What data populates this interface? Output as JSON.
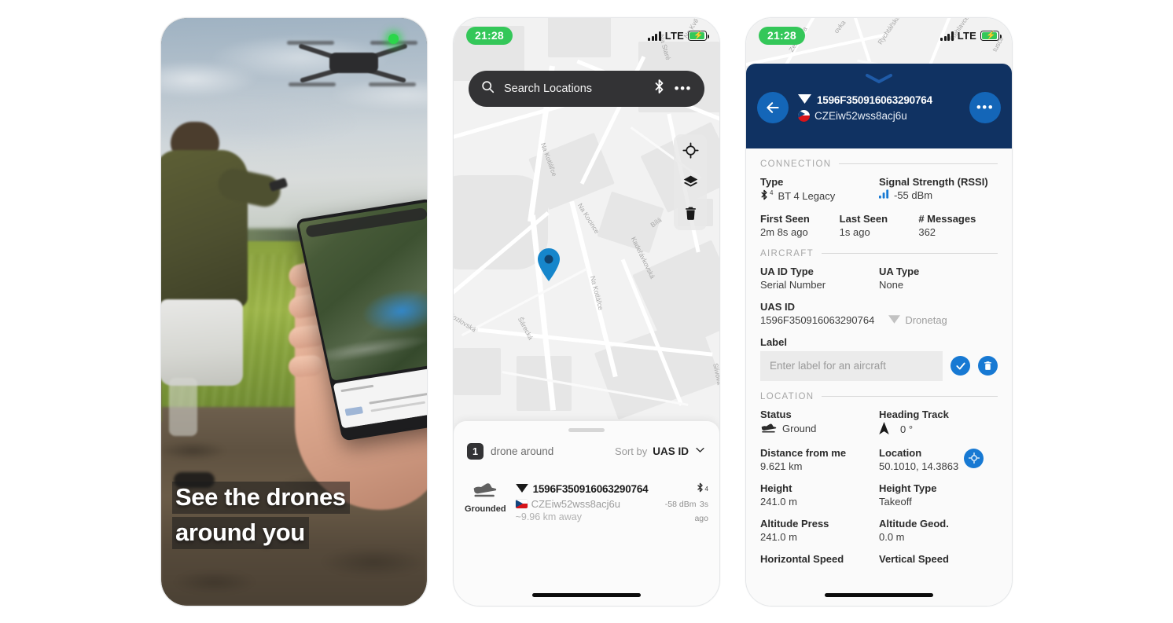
{
  "hero": {
    "caption_line1": "See the drones",
    "caption_line2": "around you"
  },
  "status_bar": {
    "time": "21:28",
    "network": "LTE",
    "battery_charging": true
  },
  "map_screen": {
    "search": {
      "placeholder": "Search Locations"
    },
    "tools": [
      {
        "name": "locate-icon"
      },
      {
        "name": "layers-icon"
      },
      {
        "name": "trash-icon"
      }
    ],
    "street_labels": [
      "Na Kocince",
      "Na Kotlářce",
      "Na Kotlářce",
      "Kadeřávkovská",
      "Šárecká",
      "Kozlovská",
      "Bílá",
      "Na Staré",
      "Na Kvě",
      "Slívova"
    ],
    "sheet": {
      "count": "1",
      "count_label": "drone around",
      "sort_label": "Sort by",
      "sort_value": "UAS ID",
      "rows": [
        {
          "status": "Grounded",
          "uas_id": "1596F350916063290764",
          "operator_id": "CZEiw52wss8acj6u",
          "distance": "~9.96 km away",
          "bt_version": "4",
          "rssi": "-58 dBm",
          "last_seen": "3s ago",
          "flag": "cz"
        }
      ]
    }
  },
  "detail_screen": {
    "header": {
      "uas_id": "1596F350916063290764",
      "operator_id": "CZEiw52wss8acj6u"
    },
    "sections": {
      "connection": {
        "title": "CONNECTION",
        "type_label": "Type",
        "type_value": "BT 4 Legacy",
        "rssi_label": "Signal Strength (RSSI)",
        "rssi_value": "-55 dBm",
        "first_seen_label": "First Seen",
        "first_seen_value": "2m 8s ago",
        "last_seen_label": "Last Seen",
        "last_seen_value": "1s ago",
        "messages_label": "# Messages",
        "messages_value": "362"
      },
      "aircraft": {
        "title": "AIRCRAFT",
        "ua_id_type_label": "UA ID Type",
        "ua_id_type_value": "Serial Number",
        "ua_type_label": "UA Type",
        "ua_type_value": "None",
        "uas_id_label": "UAS ID",
        "uas_id_value": "1596F350916063290764",
        "vendor": "Dronetag",
        "label_label": "Label",
        "label_placeholder": "Enter label for an aircraft"
      },
      "location": {
        "title": "LOCATION",
        "status_label": "Status",
        "status_value": "Ground",
        "heading_label": "Heading Track",
        "heading_value": "0 °",
        "distance_label": "Distance from me",
        "distance_value": "9.621 km",
        "location_label": "Location",
        "location_value": "50.1010, 14.3863",
        "height_label": "Height",
        "height_value": "241.0 m",
        "height_type_label": "Height Type",
        "height_type_value": "Takeoff",
        "alt_press_label": "Altitude Press",
        "alt_press_value": "241.0 m",
        "alt_geod_label": "Altitude Geod.",
        "alt_geod_value": "0.0 m",
        "h_speed_label": "Horizontal Speed",
        "v_speed_label": "Vertical Speed"
      }
    }
  },
  "colors": {
    "navy": "#103262",
    "blue": "#1779d3",
    "green": "#34c759",
    "dark": "#333335"
  }
}
